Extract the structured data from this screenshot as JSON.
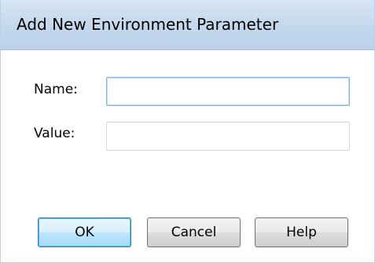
{
  "dialog": {
    "title": "Add New Environment Parameter"
  },
  "form": {
    "name_label": "Name:",
    "name_value": "",
    "value_label": "Value:",
    "value_value": ""
  },
  "buttons": {
    "ok_label": "OK",
    "cancel_label": "Cancel",
    "help_label": "Help"
  },
  "colors": {
    "title_bar": "#c3d7ec",
    "focus_border": "#7eb4ea",
    "default_button_border": "#3c7fb1"
  }
}
